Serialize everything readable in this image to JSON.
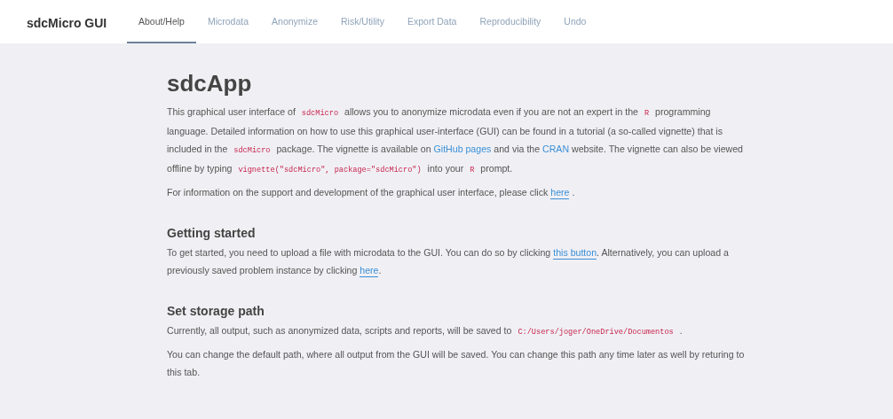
{
  "navbar": {
    "brand": "sdcMicro GUI",
    "tabs": [
      {
        "label": "About/Help",
        "selected": true
      },
      {
        "label": "Microdata",
        "selected": false
      },
      {
        "label": "Anonymize",
        "selected": false
      },
      {
        "label": "Risk/Utility",
        "selected": false
      },
      {
        "label": "Export Data",
        "selected": false
      },
      {
        "label": "Reproducibility",
        "selected": false
      },
      {
        "label": "Undo",
        "selected": false
      }
    ]
  },
  "sections": [
    {
      "heading": "sdcApp",
      "kind": "main",
      "paragraphs": [
        [
          {
            "kind": "text",
            "text": "This graphical user interface of "
          },
          {
            "kind": "code",
            "text": "sdcMicro"
          },
          {
            "kind": "text",
            "text": " allows you to anonymize microdata even if you are not an expert in the "
          },
          {
            "kind": "code",
            "text": "R"
          },
          {
            "kind": "text",
            "text": " programming language. Detailed information on how to use this graphical user-interface (GUI) can be found in a tutorial (a so-called vignette) that is included in the "
          },
          {
            "kind": "code",
            "text": "sdcMicro"
          },
          {
            "kind": "text",
            "text": " package. The vignette is available on "
          },
          {
            "kind": "link",
            "text": "GitHub pages"
          },
          {
            "kind": "text",
            "text": " and via the "
          },
          {
            "kind": "link",
            "text": "CRAN"
          },
          {
            "kind": "text",
            "text": " website. The vignette can also be viewed offline by typing "
          },
          {
            "kind": "code",
            "text": "vignette(\"sdcMicro\", package=\"sdcMicro\")"
          },
          {
            "kind": "text",
            "text": " into your "
          },
          {
            "kind": "code",
            "text": "R"
          },
          {
            "kind": "text",
            "text": " prompt."
          }
        ],
        [
          {
            "kind": "text",
            "text": "For information on the support and development of the graphical user interface, please click "
          },
          {
            "kind": "button-link",
            "text": "here"
          },
          {
            "kind": "text",
            "text": " ."
          }
        ]
      ]
    },
    {
      "heading": "Getting started",
      "kind": "sub",
      "paragraphs": [
        [
          {
            "kind": "text",
            "text": "To get started, you need to upload a file with microdata to the GUI. You can do so by clicking "
          },
          {
            "kind": "button-link",
            "text": "this button"
          },
          {
            "kind": "text",
            "text": ". Alternatively, you can upload a previously saved problem instance by clicking "
          },
          {
            "kind": "button-link",
            "text": "here"
          },
          {
            "kind": "text",
            "text": "."
          }
        ]
      ]
    },
    {
      "heading": "Set storage path",
      "kind": "sub",
      "paragraphs": [
        [
          {
            "kind": "text",
            "text": "Currently, all output, such as anonymized data, scripts and reports, will be saved to "
          },
          {
            "kind": "code",
            "text": "C:/Users/joger/OneDrive/Documentos"
          },
          {
            "kind": "text",
            "text": " ."
          }
        ],
        [
          {
            "kind": "text",
            "text": "You can change the default path, where all output from the GUI will be saved. You can change this path any time later as well by returing to this tab."
          }
        ]
      ]
    }
  ]
}
